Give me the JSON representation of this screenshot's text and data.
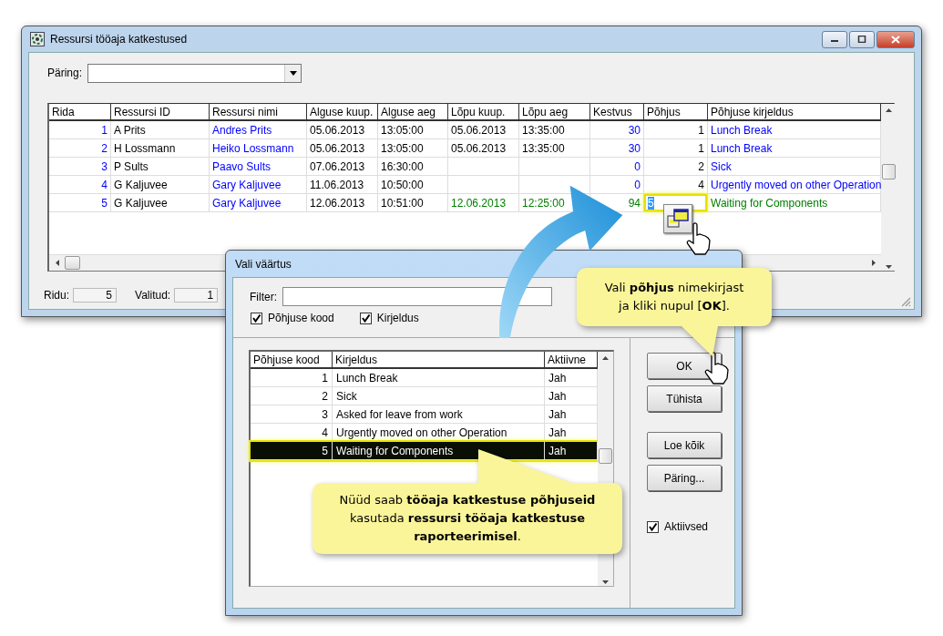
{
  "main_window": {
    "title": "Ressursi tööaja katkestused",
    "query_label": "Päring:",
    "grid": {
      "columns": [
        "Rida",
        "Ressursi ID",
        "Ressursi nimi",
        "Alguse kuup.",
        "Alguse aeg",
        "Lõpu kuup.",
        "Lõpu aeg",
        "Kestvus",
        "Põhjus",
        "Põhjuse kirjeldus"
      ],
      "rows": [
        {
          "cells": [
            "1",
            "A Prits",
            "Andres Prits",
            "05.06.2013",
            "13:05:00",
            "05.06.2013",
            "13:35:00",
            "30",
            "1",
            "Lunch Break"
          ],
          "color": "#0000ff",
          "selected": false
        },
        {
          "cells": [
            "2",
            "H Lossmann",
            "Heiko Lossmann",
            "05.06.2013",
            "13:05:00",
            "05.06.2013",
            "13:35:00",
            "30",
            "1",
            "Lunch Break"
          ],
          "color": "#0000ff",
          "selected": false
        },
        {
          "cells": [
            "3",
            "P Sults",
            "Paavo Sults",
            "07.06.2013",
            "16:30:00",
            "",
            "",
            "0",
            "2",
            "Sick"
          ],
          "color": "#0000ff",
          "selected": false
        },
        {
          "cells": [
            "4",
            "G Kaljuvee",
            "Gary Kaljuvee",
            "11.06.2013",
            "10:50:00",
            "",
            "",
            "0",
            "4",
            "Urgently moved on other Operation"
          ],
          "color": "#0000ff",
          "selected": false
        },
        {
          "cells": [
            "5",
            "G Kaljuvee",
            "Gary Kaljuvee",
            "12.06.2013",
            "10:51:00",
            "12.06.2013",
            "12:25:00",
            "94",
            "5",
            "Waiting for Components"
          ],
          "color": "#008000",
          "selected": true
        }
      ]
    },
    "status_bar": [
      {
        "label": "Ridu:",
        "value": "5"
      },
      {
        "label": "Valitud:",
        "value": "1"
      }
    ]
  },
  "dialog": {
    "title": "Vali väärtus",
    "filter_label": "Filter:",
    "checkboxes": [
      {
        "label": "Põhjuse kood",
        "checked": true
      },
      {
        "label": "Kirjeldus",
        "checked": true
      }
    ],
    "list": {
      "columns": [
        "Põhjuse kood",
        "Kirjeldus",
        "Aktiivne"
      ],
      "rows": [
        {
          "cells": [
            "1",
            "Lunch Break",
            "Jah"
          ],
          "selected": false
        },
        {
          "cells": [
            "2",
            "Sick",
            "Jah"
          ],
          "selected": false
        },
        {
          "cells": [
            "3",
            "Asked for leave from work",
            "Jah"
          ],
          "selected": false
        },
        {
          "cells": [
            "4",
            "Urgently moved on other Operation",
            "Jah"
          ],
          "selected": false
        },
        {
          "cells": [
            "5",
            "Waiting for Components",
            "Jah"
          ],
          "selected": true
        }
      ]
    },
    "buttons": [
      "OK",
      "Tühista",
      "Loe kõik",
      "Päring..."
    ],
    "active_filter": {
      "label": "Aktiivsed",
      "checked": true
    }
  },
  "callouts": [
    {
      "lines": [
        "Vali **põhjus** nimekirjast",
        "ja kliki nupul [**OK**]."
      ]
    },
    {
      "lines": [
        "Nüüd saab **tööaja katkestuse põhjuseid**",
        "kasutada **ressursi tööaja katkestuse**",
        "**raporteerimisel**."
      ]
    }
  ]
}
